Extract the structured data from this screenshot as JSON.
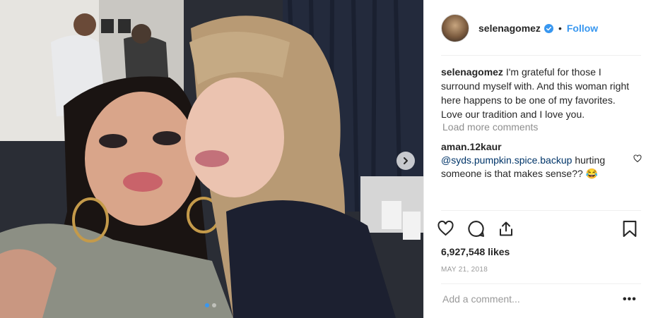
{
  "header": {
    "username": "selenagomez",
    "bullet": "•",
    "follow_label": "Follow"
  },
  "caption": {
    "username": "selenagomez",
    "text": "I'm grateful for those I surround myself with. And this woman right here happens to be one of my favorites. Love our tradition and I love you."
  },
  "load_more": "Load more comments",
  "comment": {
    "username": "aman.12kaur",
    "mention": "@syds.pumpkin.spice.backup",
    "text": "hurting someone is that makes sense??",
    "emoji": "😂"
  },
  "likes": "6,927,548 likes",
  "date": "MAY 21, 2018",
  "add_comment_placeholder": "Add a comment...",
  "more_label": "•••",
  "carousel": {
    "total": 2,
    "active": 1
  },
  "icons": [
    "heart-icon",
    "comment-icon",
    "share-icon",
    "bookmark-icon",
    "verified-badge-icon",
    "chevron-right-icon"
  ],
  "colors": {
    "accent": "#3897f0",
    "mention": "#003569",
    "muted": "#8e8e8e"
  }
}
